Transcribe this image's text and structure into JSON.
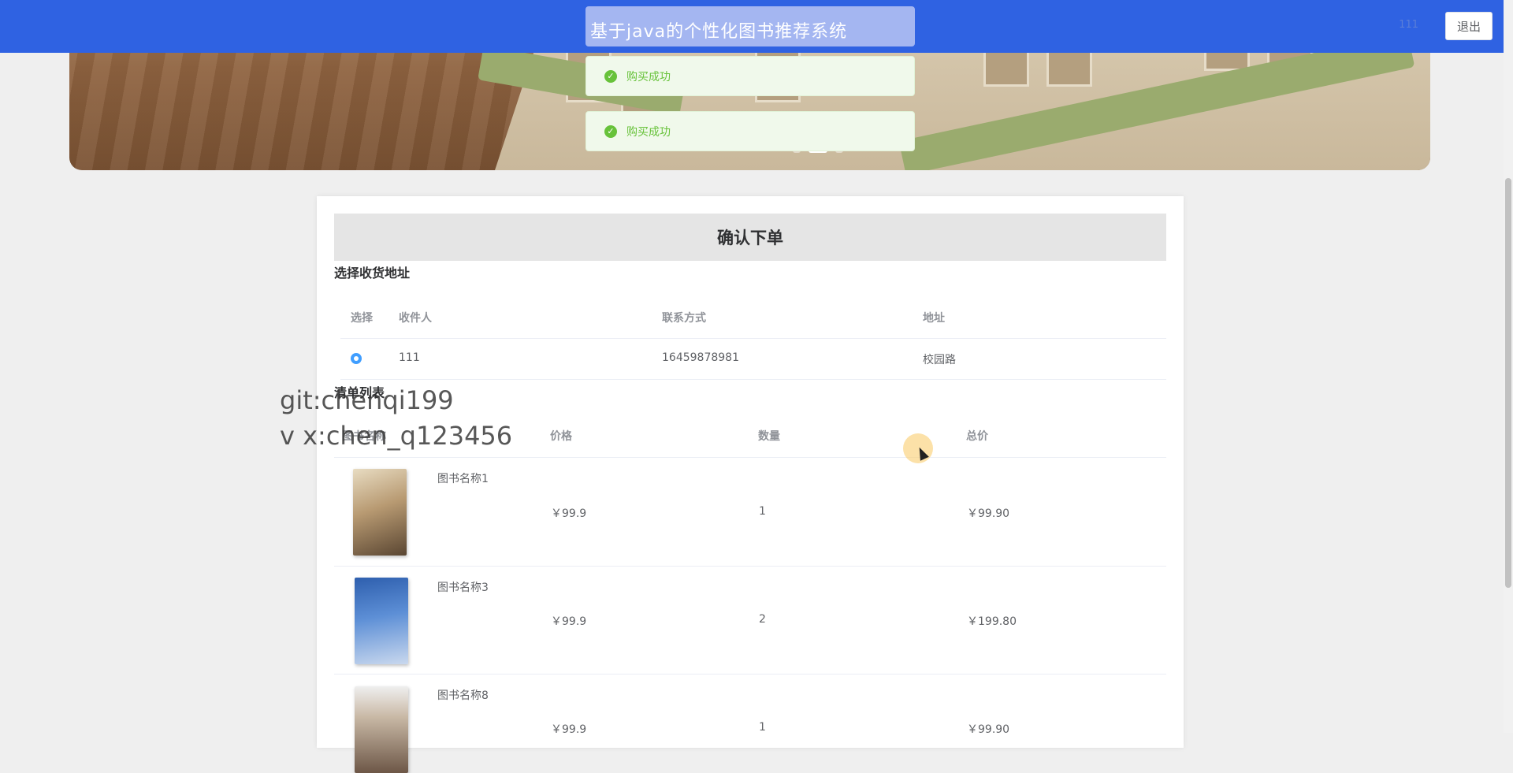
{
  "header": {
    "site_title": "基于java的个性化图书推荐系统",
    "user_name": "111",
    "logout_label": "退出"
  },
  "banner": {
    "carousel_total": 3,
    "carousel_active": 2
  },
  "toasts": [
    {
      "text": "购买成功"
    },
    {
      "text": "购买成功"
    }
  ],
  "order": {
    "title": "确认下单",
    "address_section": "选择收货地址",
    "address_headers": {
      "select": "选择",
      "receiver": "收件人",
      "phone": "联系方式",
      "address": "地址"
    },
    "addresses": [
      {
        "selected": true,
        "receiver": "111",
        "phone": "16459878981",
        "address": "校园路"
      }
    ],
    "list_section": "清单列表",
    "list_headers": {
      "name": "图书名称",
      "price": "价格",
      "qty": "数量",
      "total": "总价"
    },
    "items": [
      {
        "name": "图书名称1",
        "price": "￥99.9",
        "qty": "1",
        "total": "￥99.90",
        "cover": "book-cover-1"
      },
      {
        "name": "图书名称3",
        "price": "￥99.9",
        "qty": "2",
        "total": "￥199.80",
        "cover": "book-cover-3"
      },
      {
        "name": "图书名称8",
        "price": "￥99.9",
        "qty": "1",
        "total": "￥99.90",
        "cover": "book-cover-8"
      }
    ]
  },
  "watermark": {
    "line1": "git:chenqi199",
    "line2": "v x:chen_q123456"
  },
  "colors": {
    "header_bg": "#2f62e2",
    "toast_success": "#67c23a",
    "radio_active": "#409eff"
  }
}
